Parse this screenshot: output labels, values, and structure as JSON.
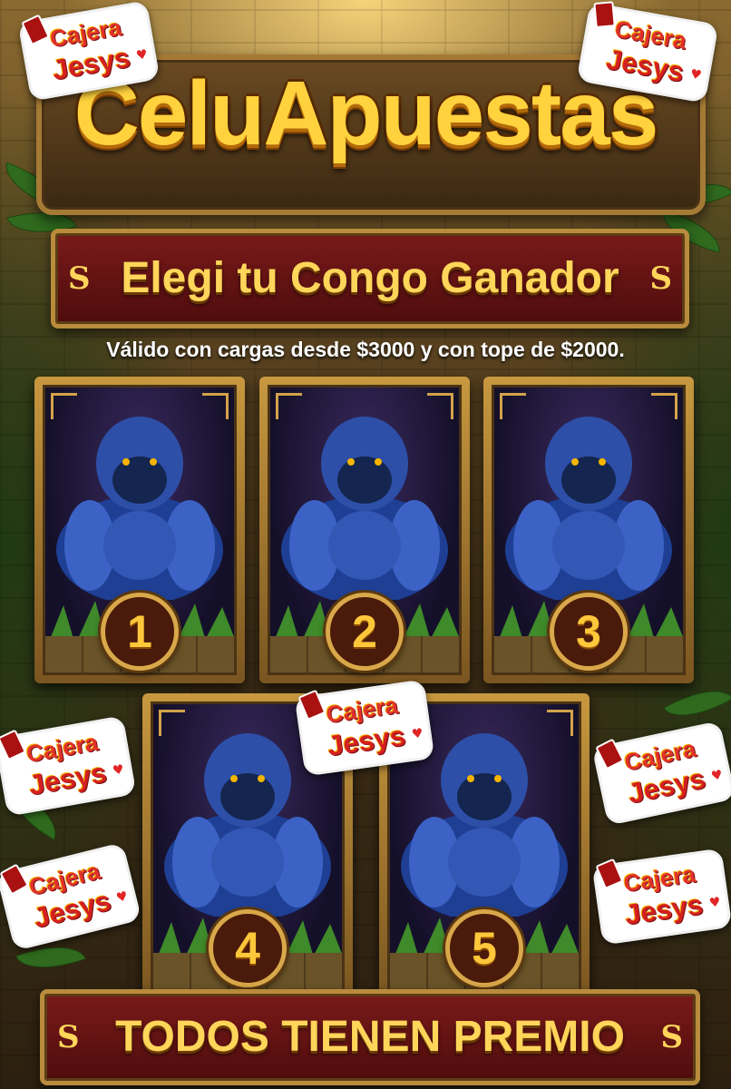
{
  "brand": {
    "title": "CeluApuestas"
  },
  "banner_top": {
    "text": "Elegi tu Congo Ganador",
    "ornament": "S"
  },
  "validity": "Válido con cargas desde $3000 y con tope de $2000.",
  "cards": [
    {
      "number": "1"
    },
    {
      "number": "2"
    },
    {
      "number": "3"
    },
    {
      "number": "4"
    },
    {
      "number": "5"
    }
  ],
  "banner_bottom": {
    "text": "TODOS TIENEN PREMIO",
    "ornament": "S"
  },
  "stickers": [
    {
      "line1": "Cajera",
      "line2": "Jesys"
    },
    {
      "line1": "Cajera",
      "line2": "Jesys"
    },
    {
      "line1": "Cajera",
      "line2": "Jesys"
    },
    {
      "line1": "Cajera",
      "line2": "Jesys"
    },
    {
      "line1": "Cajera",
      "line2": "Jesys"
    },
    {
      "line1": "Cajera",
      "line2": "Jesys"
    },
    {
      "line1": "Cajera",
      "line2": "Jesys"
    }
  ],
  "colors": {
    "gold": "#ffd23e",
    "banner_red": "#7a1a1a",
    "gorilla_blue": "#2d4fa8"
  },
  "icons": {
    "card_art": "gorilla-icon",
    "sticker_heart": "heart-icon"
  }
}
